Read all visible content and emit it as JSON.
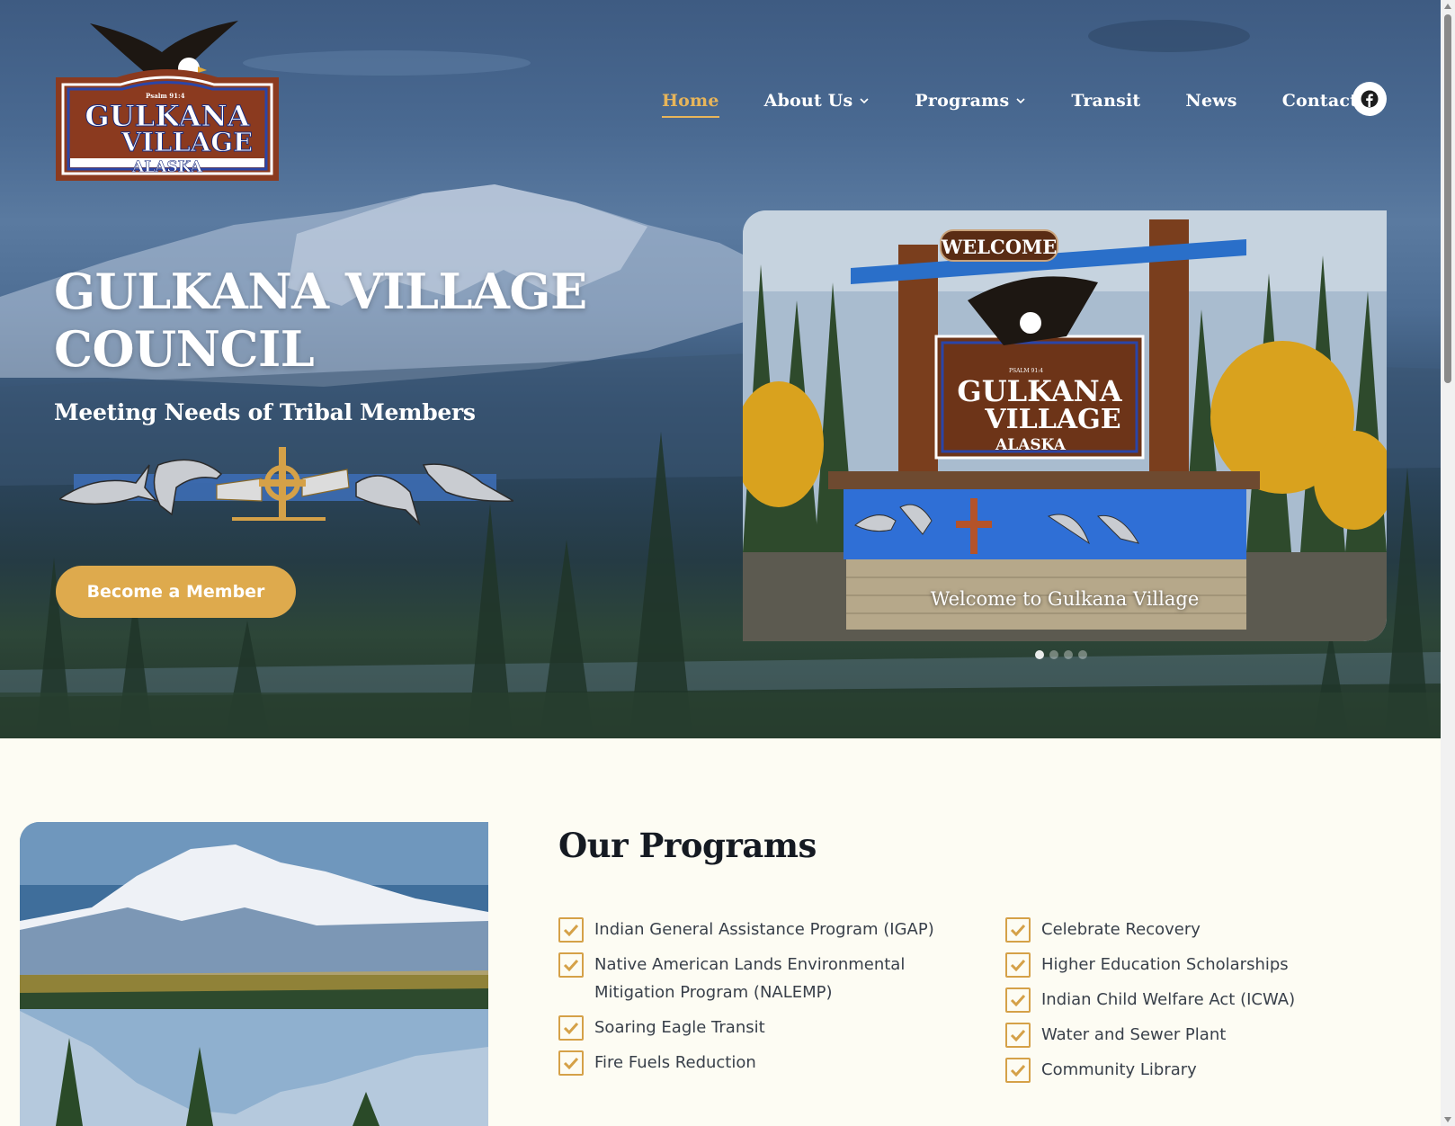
{
  "brand": {
    "logo_top_text": "Psalm 91:4",
    "logo_line1": "GULKANA",
    "logo_line2": "VILLAGE",
    "logo_line3": "ALASKA"
  },
  "nav": {
    "items": [
      {
        "label": "Home",
        "active": true,
        "dropdown": false
      },
      {
        "label": "About Us",
        "active": false,
        "dropdown": true
      },
      {
        "label": "Programs",
        "active": false,
        "dropdown": true
      },
      {
        "label": "Transit",
        "active": false,
        "dropdown": false
      },
      {
        "label": "News",
        "active": false,
        "dropdown": false
      },
      {
        "label": "Contact",
        "active": false,
        "dropdown": false
      }
    ],
    "social_icon": "facebook-icon"
  },
  "hero": {
    "title_line1": "GULKANA VILLAGE",
    "title_line2": "COUNCIL",
    "subtitle": "Meeting Needs of Tribal Members",
    "cta_label": "Become a Member"
  },
  "slider": {
    "caption": "Welcome to Gulkana Village",
    "sign_welcome": "WELCOME",
    "sign_line1": "GULKANA",
    "sign_line2": "VILLAGE",
    "sign_line3": "ALASKA",
    "sign_small": "PSALM 91:4",
    "slide_count": 4,
    "active_slide": 1
  },
  "programs": {
    "title": "Our Programs",
    "column1": [
      "Indian General Assistance Program (IGAP)",
      "Native American Lands Environmental Mitigation Program (NALEMP)",
      "Soaring Eagle Transit",
      "Fire Fuels Reduction"
    ],
    "column2": [
      "Celebrate Recovery",
      "Higher Education Scholarships",
      "Indian Child Welfare Act (ICWA)",
      "Water and Sewer Plant",
      "Community Library"
    ]
  },
  "colors": {
    "accent": "#deaa4d",
    "nav_active": "#e7b55a",
    "hero_blue": "#3e5b82",
    "page_bg": "#fdfcf3",
    "check_border": "#d5a148"
  }
}
